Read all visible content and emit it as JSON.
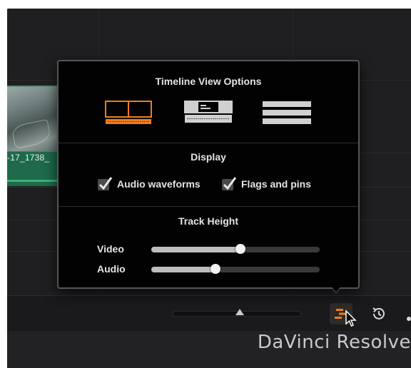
{
  "timeline": {
    "clip_label": "-17_1738_"
  },
  "popover": {
    "title": "Timeline View Options",
    "view_modes": [
      {
        "name": "thumbnail-view",
        "selected": true
      },
      {
        "name": "filmstrip-view",
        "selected": false
      },
      {
        "name": "simplified-view",
        "selected": false
      }
    ],
    "display": {
      "title": "Display",
      "audio_waveforms_label": "Audio waveforms",
      "audio_waveforms_checked": true,
      "flags_pins_label": "Flags and pins",
      "flags_pins_checked": true
    },
    "track_height": {
      "title": "Track Height",
      "video_label": "Video",
      "video_value": 0.53,
      "audio_label": "Audio",
      "audio_value": 0.38
    }
  },
  "toolbar": {
    "zoom_value": 0.5,
    "active_button_icon": "timeline-view-options-icon",
    "history_icon": "history-icon"
  },
  "app": {
    "name": "DaVinci Resolve"
  },
  "colors": {
    "accent": "#f07c1c",
    "popover_bg": "#020202",
    "clip_audio": "#1e6a4b"
  }
}
